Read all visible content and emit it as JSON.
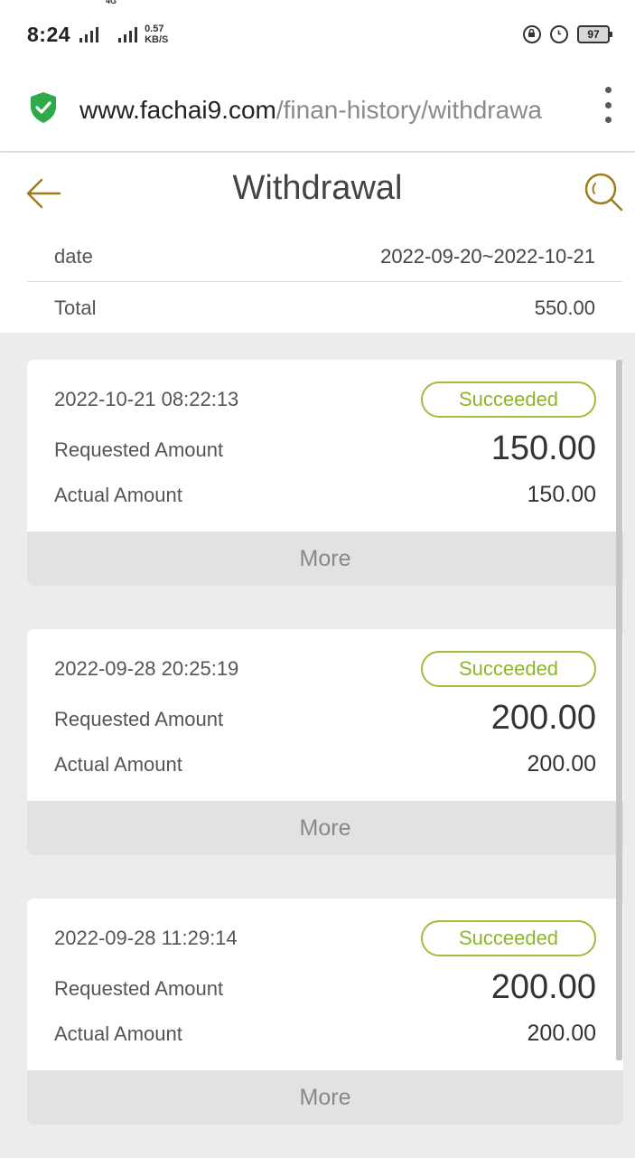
{
  "status_bar": {
    "time": "8:24",
    "network": "4G",
    "speed_value": "0.57",
    "speed_unit": "KB/S",
    "battery": "97",
    "icons": [
      "signal-icon",
      "rotation-lock-icon",
      "alarm-icon",
      "battery-icon"
    ]
  },
  "browser": {
    "url_host": "www.fachai9.com",
    "url_path": "/finan-history/withdrawa",
    "icons": [
      "secure-shield-icon",
      "menu-dots-icon"
    ],
    "accent_color": "#2eaa4c"
  },
  "header": {
    "title": "Withdrawal",
    "icons": [
      "back-arrow-icon",
      "search-icon"
    ],
    "icon_color": "#a07d1c"
  },
  "summary": {
    "date_label": "date",
    "date_value": "2022-09-20~2022-10-21",
    "total_label": "Total",
    "total_value": "550.00"
  },
  "records": [
    {
      "datetime": "2022-10-21 08:22:13",
      "status": "Succeeded",
      "requested_label": "Requested Amount",
      "requested_value": "150.00",
      "actual_label": "Actual Amount",
      "actual_value": "150.00",
      "more_label": "More"
    },
    {
      "datetime": "2022-09-28 20:25:19",
      "status": "Succeeded",
      "requested_label": "Requested Amount",
      "requested_value": "200.00",
      "actual_label": "Actual Amount",
      "actual_value": "200.00",
      "more_label": "More"
    },
    {
      "datetime": "2022-09-28 11:29:14",
      "status": "Succeeded",
      "requested_label": "Requested Amount",
      "requested_value": "200.00",
      "actual_label": "Actual Amount",
      "actual_value": "200.00",
      "more_label": "More"
    }
  ],
  "colors": {
    "status_green": "#8db52c",
    "page_background": "#ececec"
  }
}
